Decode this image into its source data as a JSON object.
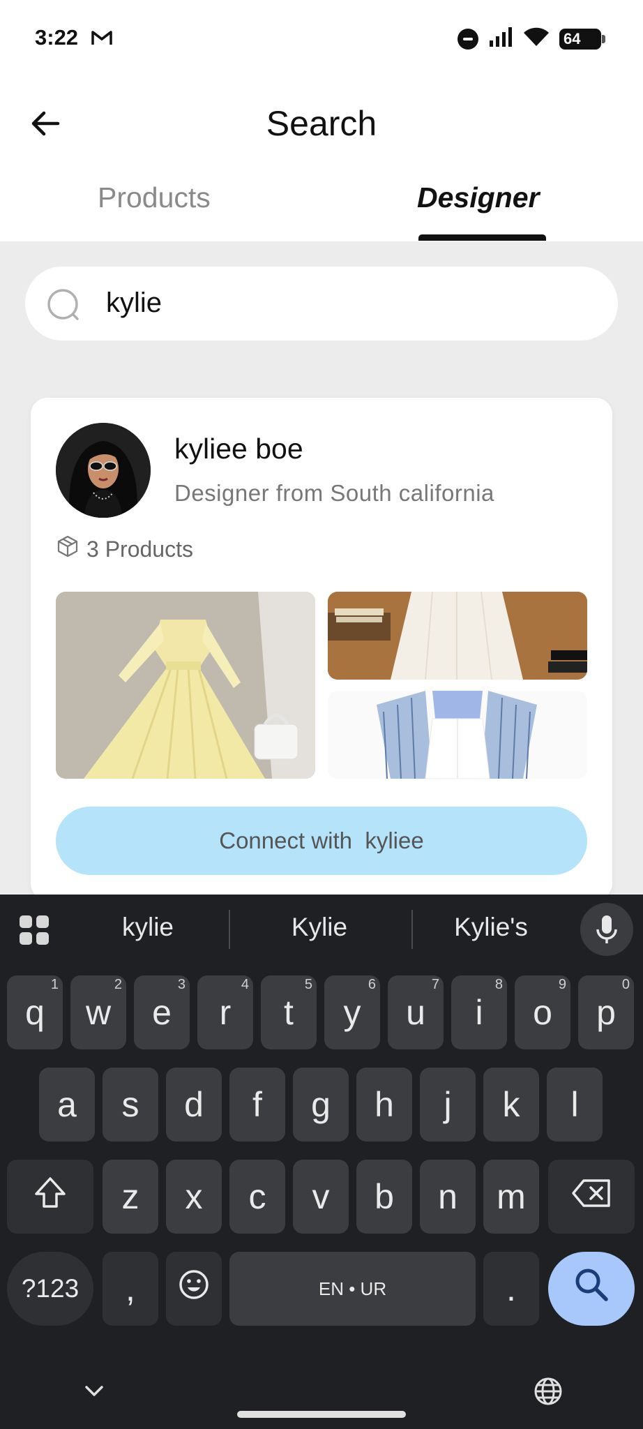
{
  "status_bar": {
    "time": "3:22",
    "battery": "64"
  },
  "header": {
    "title": "Search"
  },
  "tabs": [
    {
      "label": "Products",
      "active": false
    },
    {
      "label": "Designer",
      "active": true
    }
  ],
  "search": {
    "value": "kylie"
  },
  "designer_card": {
    "name": "kyliee boe",
    "subtitle": "Designer from South california",
    "product_count": "3 Products",
    "connect_label": "Connect with  kyliee"
  },
  "keyboard": {
    "suggestions": [
      "kylie",
      "Kylie",
      "Kylie's"
    ],
    "row1": [
      {
        "k": "q",
        "n": "1"
      },
      {
        "k": "w",
        "n": "2"
      },
      {
        "k": "e",
        "n": "3"
      },
      {
        "k": "r",
        "n": "4"
      },
      {
        "k": "t",
        "n": "5"
      },
      {
        "k": "y",
        "n": "6"
      },
      {
        "k": "u",
        "n": "7"
      },
      {
        "k": "i",
        "n": "8"
      },
      {
        "k": "o",
        "n": "9"
      },
      {
        "k": "p",
        "n": "0"
      }
    ],
    "row2": [
      "a",
      "s",
      "d",
      "f",
      "g",
      "h",
      "j",
      "k",
      "l"
    ],
    "row3": [
      "z",
      "x",
      "c",
      "v",
      "b",
      "n",
      "m"
    ],
    "symbols_label": "?123",
    "comma": ",",
    "space_label": "EN • UR",
    "period": "."
  },
  "colors": {
    "connect_button": "#b5e3fa",
    "keyboard_bg": "#1f2023",
    "search_key": "#a8c7fa",
    "page_bg": "#ececec"
  }
}
